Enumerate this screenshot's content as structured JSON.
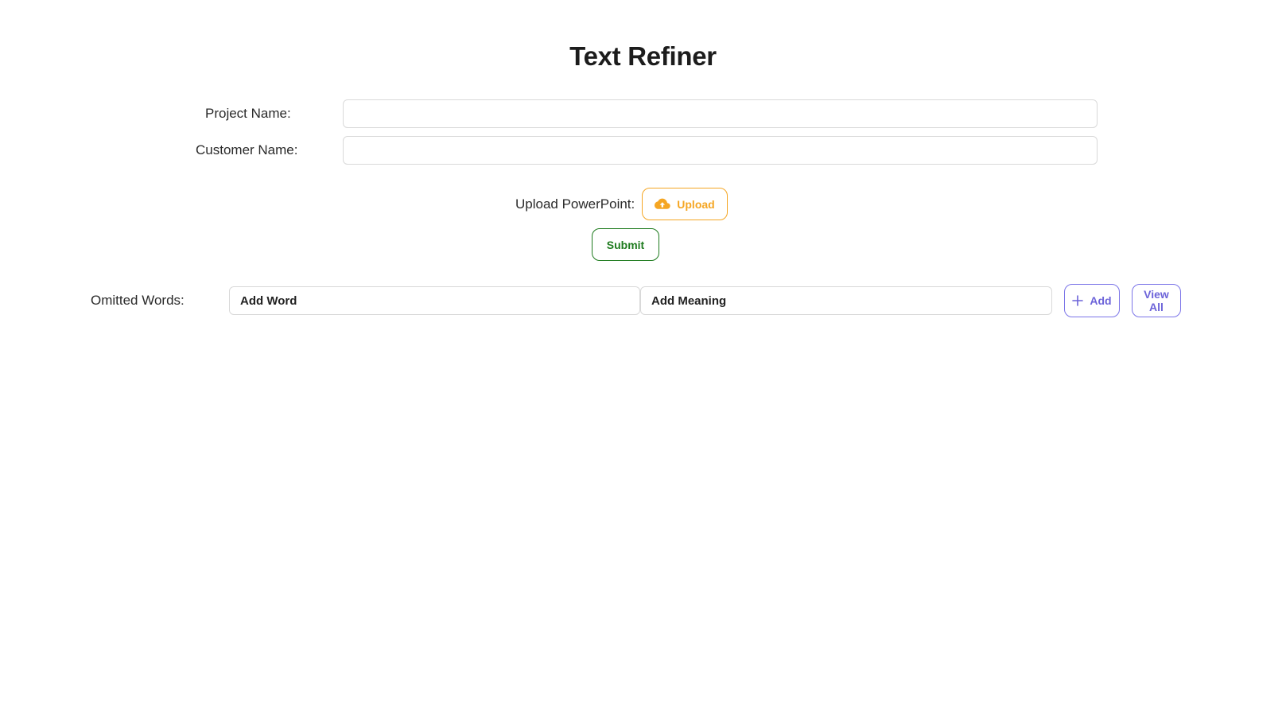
{
  "app": {
    "title": "Text Refiner"
  },
  "form": {
    "project_name_label": "Project Name:",
    "project_name_value": "",
    "customer_name_label": "Customer Name:",
    "customer_name_value": "",
    "upload_label": "Upload PowerPoint:",
    "upload_button_label": "Upload",
    "upload_icon": "cloud-upload-icon",
    "submit_button_label": "Submit"
  },
  "omitted_words": {
    "label": "Omitted Words:",
    "word_placeholder": "Add Word",
    "meaning_placeholder": "Add Meaning",
    "add_button_label": "Add",
    "add_icon": "plus-icon",
    "view_all_button_label": "View All"
  },
  "colors": {
    "upload_accent": "#f5a623",
    "submit_accent": "#1e7b1e",
    "add_accent": "#6c63d9",
    "input_border": "#d9d9d9"
  }
}
